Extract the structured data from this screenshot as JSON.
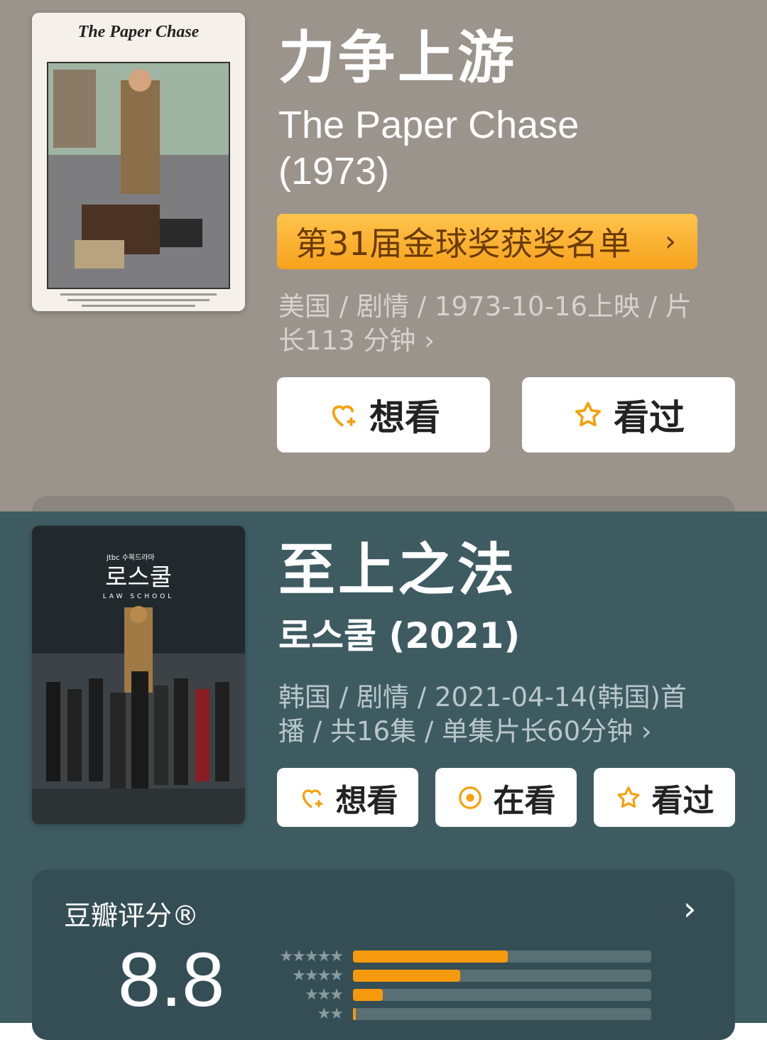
{
  "entries": [
    {
      "title_cn": "力争上游",
      "title_orig_line1": "The Paper Chase",
      "title_orig_line2": "(1973)",
      "award": "第31届金球奖获奖名单",
      "meta_line1": "美国 / 剧情 / 1973-10-16上映 / 片",
      "meta_line2": "长113 分钟",
      "poster_title": "The Paper Chase",
      "poster_tagline": "You may be looking at a future President, Supreme Court Justice, Secretary of State or a dropout.",
      "buttons": [
        "想看",
        "看过"
      ]
    },
    {
      "title_cn": "至上之法",
      "title_orig": "로스쿨 (2021)",
      "meta_line1": "韩国 / 剧情 / 2021-04-14(韩国)首",
      "meta_line2": "播 / 共16集 / 单集片长60分钟",
      "poster_logo": "로스쿨",
      "poster_sub": "LAW SCHOOL",
      "poster_network": "jtbc 수목드라마",
      "buttons": [
        "想看",
        "在看",
        "看过"
      ]
    }
  ],
  "rating": {
    "label": "豆瓣评分®",
    "score": "8.8",
    "distribution": [
      {
        "stars": "★★★★★",
        "fraction": 0.52
      },
      {
        "stars": "★★★★",
        "fraction": 0.36
      },
      {
        "stars": "★★★",
        "fraction": 0.1
      },
      {
        "stars": "★★",
        "fraction": 0.01
      }
    ]
  },
  "chevron": "›",
  "colors": {
    "section1_bg": "#9a948c",
    "section2_bg": "#3f5b62",
    "accent": "#f59a0c"
  }
}
